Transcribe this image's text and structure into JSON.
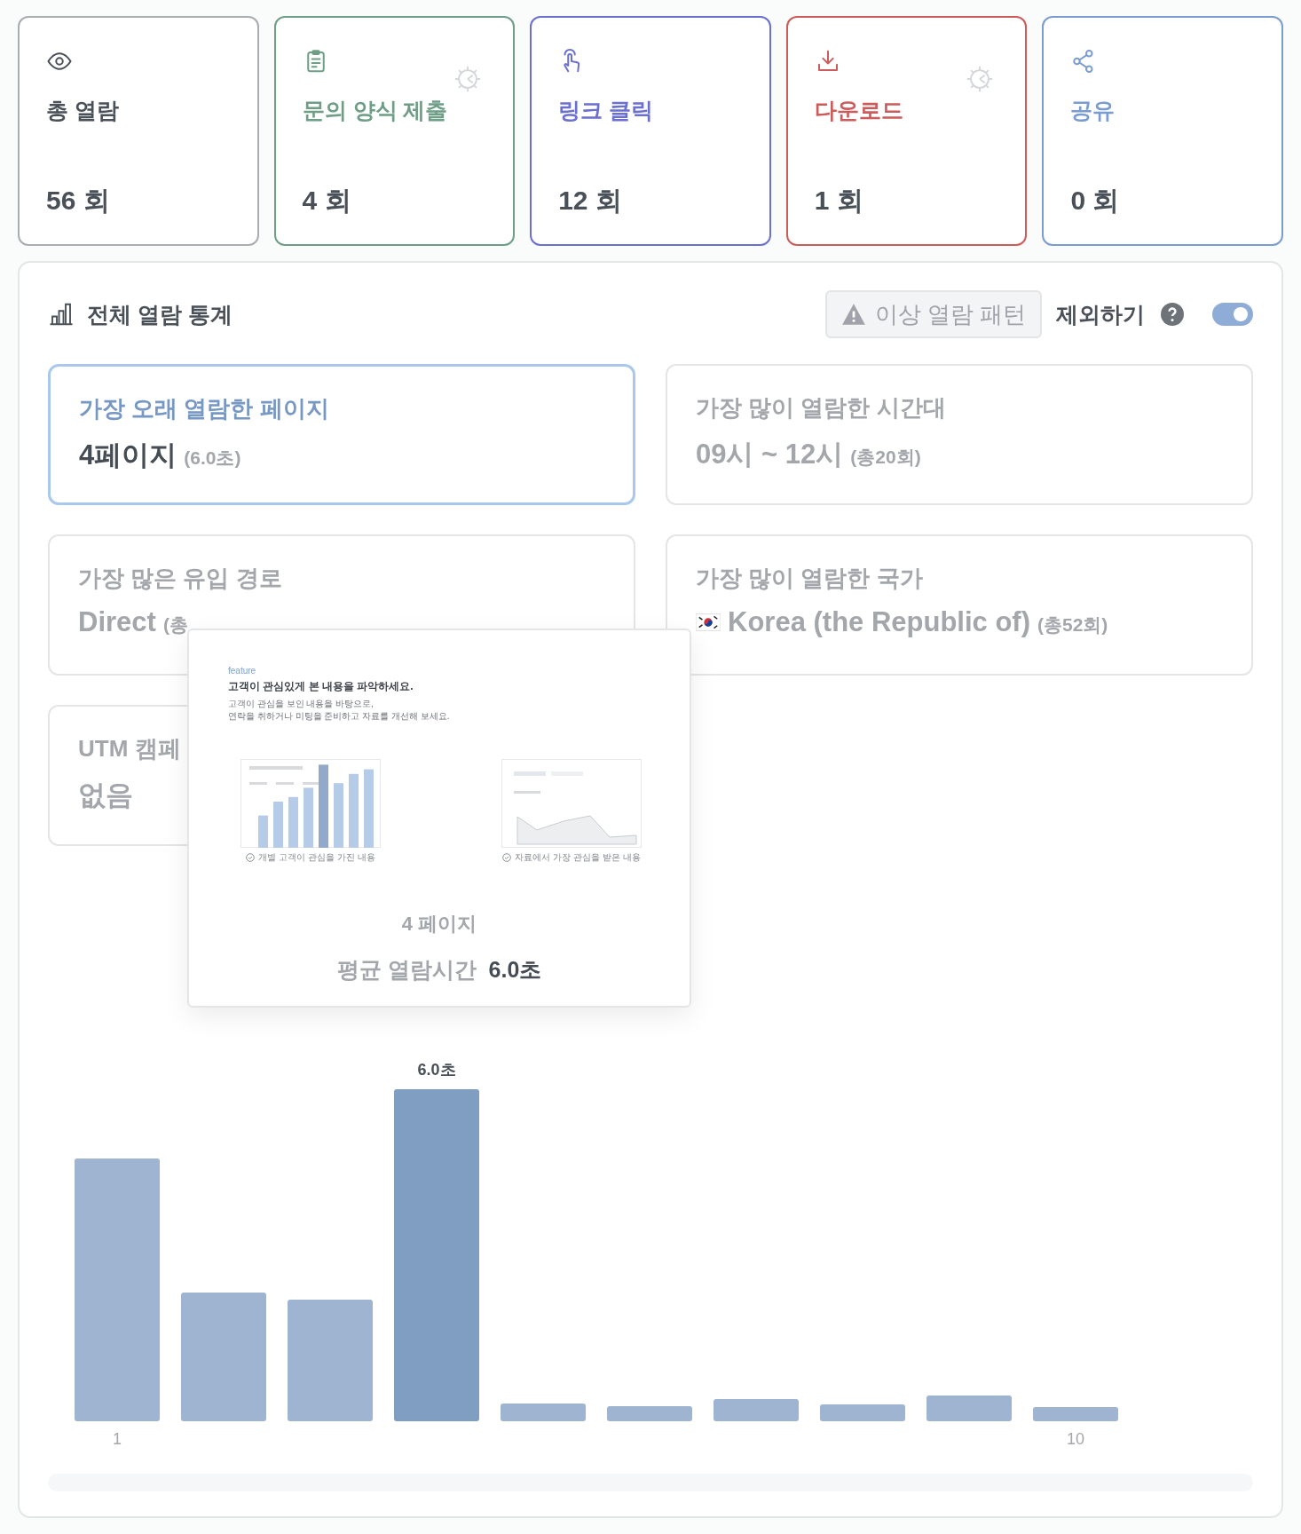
{
  "summary_cards": [
    {
      "kind": "views",
      "label": "총 열람",
      "count": "56 회",
      "color": "#4a5058",
      "settings": false
    },
    {
      "kind": "form",
      "label": "문의 양식 제출",
      "count": "4 회",
      "color": "#6f9e86",
      "settings": true
    },
    {
      "kind": "click",
      "label": "링크 클릭",
      "count": "12 회",
      "color": "#6b6fd0",
      "settings": false
    },
    {
      "kind": "download",
      "label": "다운로드",
      "count": "1 회",
      "color": "#cc5b5b",
      "settings": true
    },
    {
      "kind": "share",
      "label": "공유",
      "count": "0 회",
      "color": "#7a9cd0",
      "settings": false
    }
  ],
  "stats_panel": {
    "title": "전체 열람 통계",
    "anomaly_button": "이상 열람 패턴",
    "exclude_label": "제외하기",
    "exclude_toggle": {
      "on": true
    },
    "stat_cards": [
      {
        "kind": "plain",
        "title": "가장 오래 열람한 페이지",
        "value": "4페이지",
        "detail": "(6.0초)",
        "selected": true
      },
      {
        "kind": "plain",
        "title": "가장 많이 열람한 시간대",
        "value": "09시 ~ 12시",
        "detail": "(총20회)",
        "selected": false
      },
      {
        "kind": "plain",
        "title": "가장 많은 유입 경로",
        "value": "Direct",
        "detail": "(총",
        "selected": false
      },
      {
        "kind": "country",
        "title": "가장 많이 열람한 국가",
        "value": "Korea (the Republic of)",
        "detail": "(총52회)",
        "selected": false
      },
      {
        "kind": "plain",
        "title": "UTM 캠페",
        "value": "없음",
        "selected": false
      }
    ],
    "page_preview": {
      "tag": "feature",
      "heading": "고객이 관심있게 본 내용을 파악하세요.",
      "description": [
        "고객이 관심을 보인 내용을 바탕으로,",
        "연락을 취하거나 미팅을 준비하고 자료를 개선해 보세요."
      ],
      "captions": [
        "개별 고객이 관심을 가진 내용",
        "자료에서 가장 관심을 받은 내용"
      ],
      "page_label": "4 페이지",
      "time_label": "평균 열람시간",
      "time_value": "6.0초"
    },
    "page_chart": {
      "value_label": "6.0초",
      "axis_labels": [
        "1",
        "10"
      ]
    }
  }
}
